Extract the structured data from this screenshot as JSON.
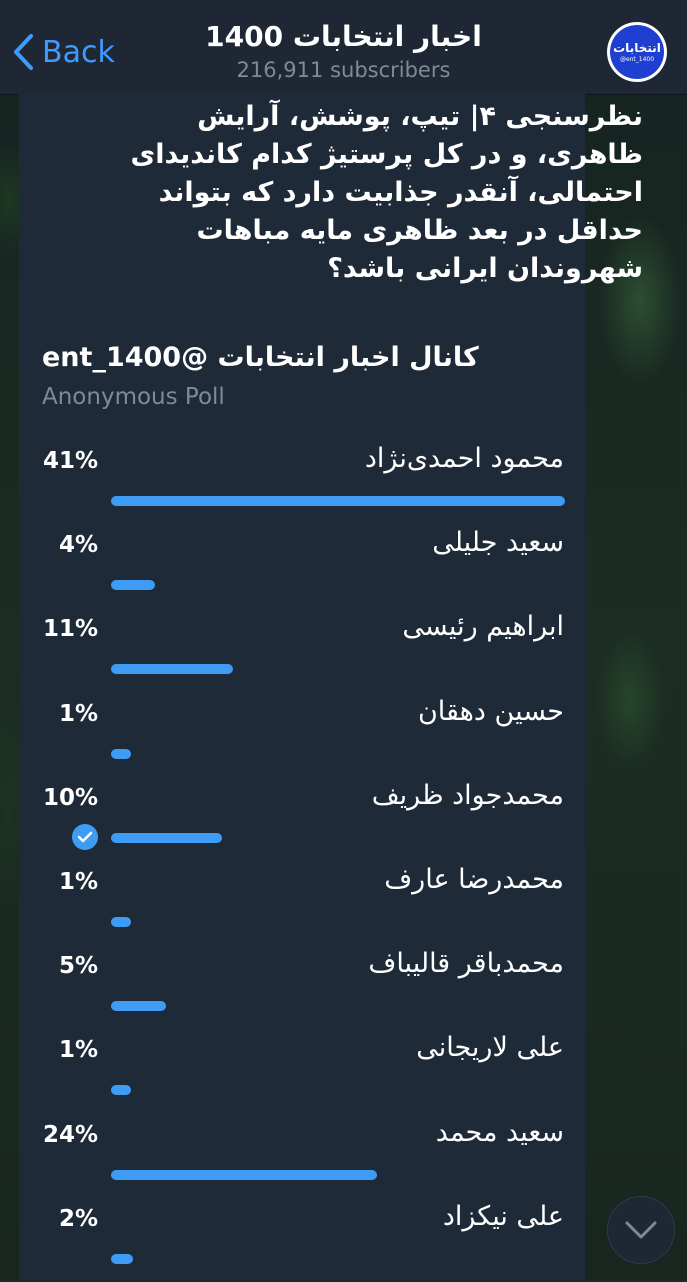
{
  "header": {
    "back_label": "Back",
    "title": "اخبار انتخابات 1400",
    "subscribers": "216,911 subscribers",
    "avatar": {
      "text": "انتخابات",
      "handle": "@ent_1400",
      "color": "#1f3fd1"
    }
  },
  "poll": {
    "question": "نظرسنجی ۴| تیپ، پوشش، آرایش ظاهری، و در کل پرستیژ کدام کاندیدای احتمالی، آنقدر جذابیت دارد که بتواند حداقل در بعد ظاهری مایه مباهات شهروندان ایرانی باشد؟",
    "channel_line": "کانال اخبار انتخابات @ent_1400",
    "type_label": "Anonymous Poll",
    "bar_color": "#3e9cf5",
    "options": [
      {
        "label": "محمود احمدی‌نژاد",
        "percent": "41%",
        "value": 41,
        "selected": false
      },
      {
        "label": "سعید جلیلی",
        "percent": "4%",
        "value": 4,
        "selected": false
      },
      {
        "label": "ابراهیم رئیسی",
        "percent": "11%",
        "value": 11,
        "selected": false
      },
      {
        "label": "حسین دهقان",
        "percent": "1%",
        "value": 1,
        "selected": false
      },
      {
        "label": "محمدجواد ظریف",
        "percent": "10%",
        "value": 10,
        "selected": true
      },
      {
        "label": "محمدرضا عارف",
        "percent": "1%",
        "value": 1,
        "selected": false
      },
      {
        "label": "محمدباقر قالیباف",
        "percent": "5%",
        "value": 5,
        "selected": false
      },
      {
        "label": "علی لاریجانی",
        "percent": "1%",
        "value": 1,
        "selected": false
      },
      {
        "label": "سعید محمد",
        "percent": "24%",
        "value": 24,
        "selected": false
      },
      {
        "label": "علی نیکزاد",
        "percent": "2%",
        "value": 2,
        "selected": false
      }
    ]
  }
}
